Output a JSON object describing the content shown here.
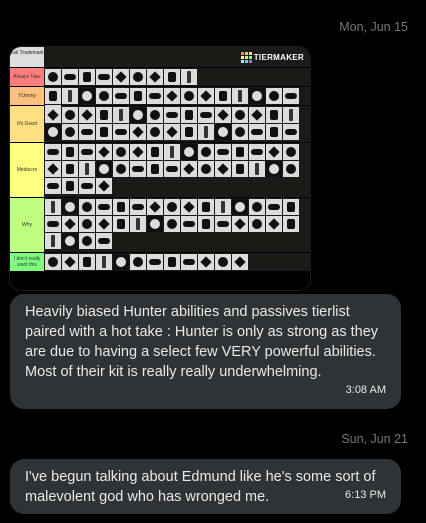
{
  "conversation": {
    "date_1": "Mon, Jun 15",
    "date_2": "Sun, Jun 21"
  },
  "tierlist": {
    "logo_text": "TIERMAKER",
    "header_label": "Evil Trademark",
    "tiers": [
      {
        "label": "Always Take",
        "color": "#ff7f7f",
        "tiles": 9
      },
      {
        "label": "YUmmy",
        "color": "#ffbf7f",
        "tiles": 16
      },
      {
        "label": "It's Good",
        "color": "#ffdf7f",
        "tiles": 30
      },
      {
        "label": "Mediocre",
        "color": "#ffff7f",
        "tiles": 34
      },
      {
        "label": "Why",
        "color": "#bfff7f",
        "tiles": 34
      },
      {
        "label": "I don't really want this",
        "color": "#7fff7f",
        "tiles": 12
      }
    ]
  },
  "messages": [
    {
      "text": "Heavily biased Hunter abilities and passives tierlist paired with a hot take : Hunter is only as strong as they are due to having a select few VERY powerful abilities. Most of their kit is really really underwhelming.",
      "time": "3:08 AM"
    },
    {
      "text": "I've begun talking about Edmund like he's some sort of malevolent god who has wronged me.",
      "time": "6:13 PM"
    }
  ]
}
